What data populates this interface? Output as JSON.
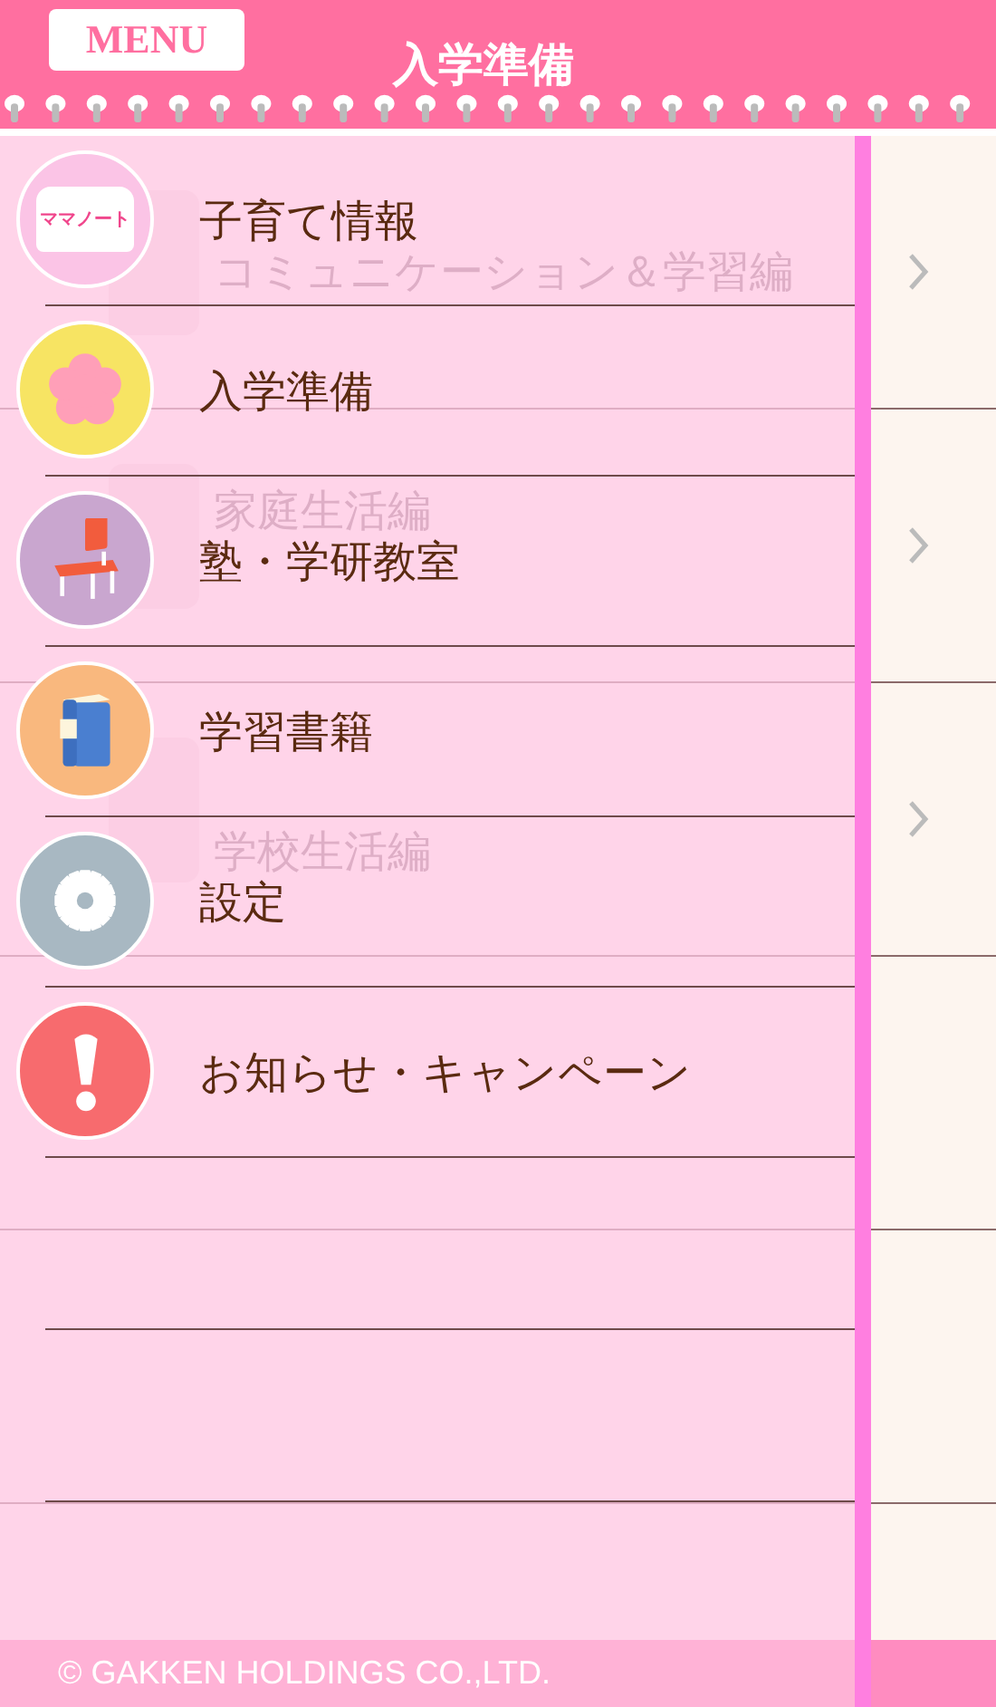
{
  "header": {
    "menu_button": "MENU",
    "title": "入学準備"
  },
  "content": {
    "rows": [
      {
        "label": "コミュニケーション＆学習編"
      },
      {
        "label": "家庭生活編"
      },
      {
        "label": "学校生活編"
      }
    ],
    "footer": "© GAKKEN HOLDINGS CO.,LTD."
  },
  "menu": {
    "items": [
      {
        "kind": "notebook",
        "label": "子育て情報",
        "badge": "ママノート"
      },
      {
        "kind": "blossom",
        "label": "入学準備"
      },
      {
        "kind": "chair",
        "label": "塾・学研教室"
      },
      {
        "kind": "book",
        "label": "学習書籍"
      },
      {
        "kind": "gear",
        "label": "設定"
      },
      {
        "kind": "alert",
        "label": "お知らせ・キャンペーン"
      }
    ]
  }
}
